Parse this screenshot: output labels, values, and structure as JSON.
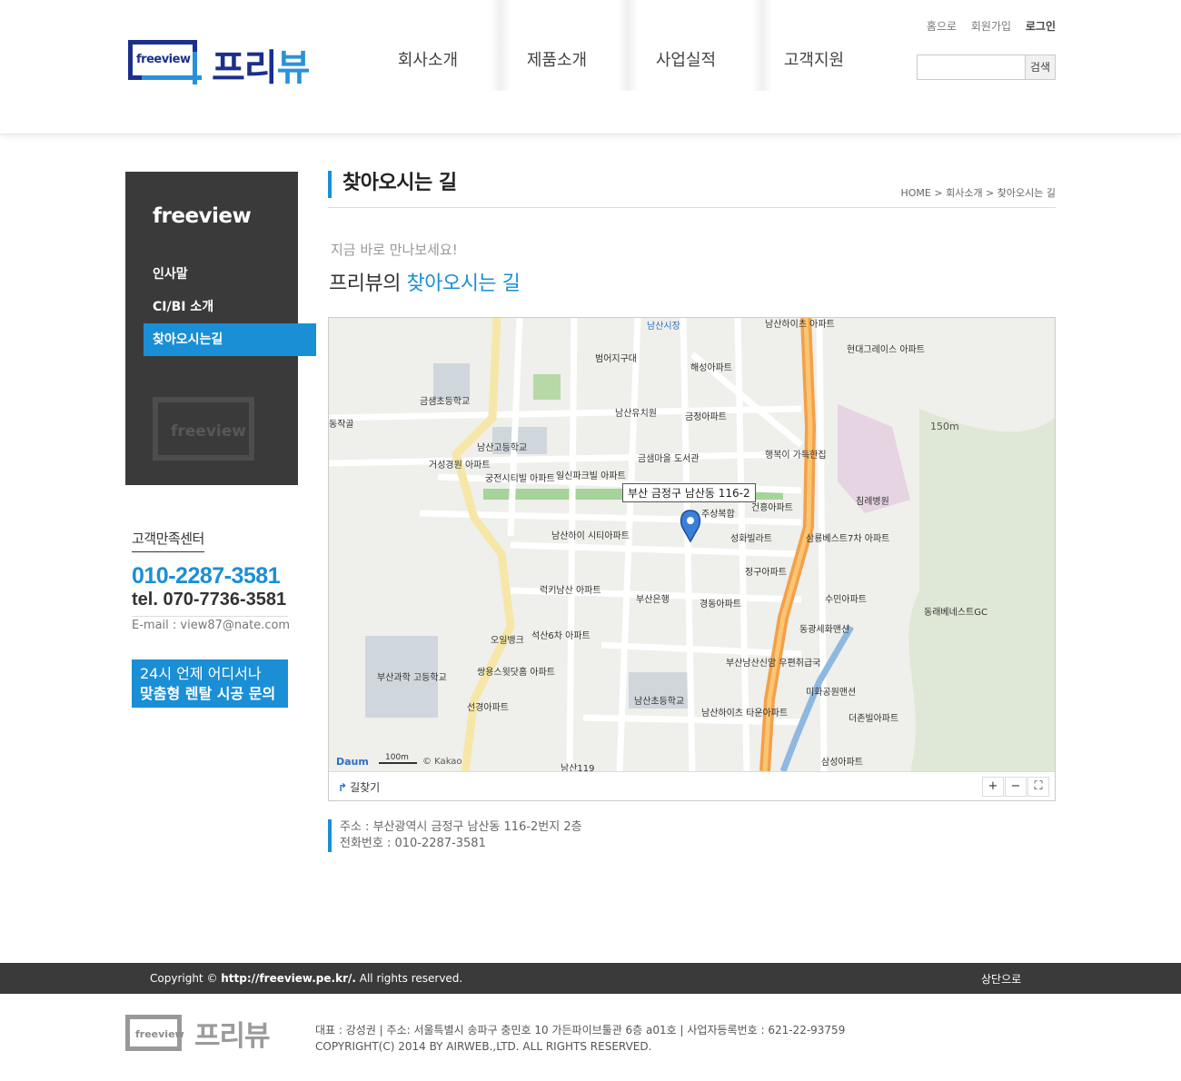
{
  "header": {
    "logo_mark_text": "freeview",
    "logo_name_a": "프리",
    "logo_name_b": "뷰",
    "nav": [
      "회사소개",
      "제품소개",
      "사업실적",
      "고객지원"
    ],
    "util": {
      "home": "홈으로",
      "join": "회원가입",
      "login": "로그인"
    },
    "search": {
      "button": "검색",
      "value": ""
    }
  },
  "sidebar": {
    "title": "freeview",
    "items": [
      {
        "label": "인사말",
        "active": false
      },
      {
        "label": "CI/BI 소개",
        "active": false
      },
      {
        "label": "찾아오시는길",
        "active": true
      }
    ],
    "watermark": "freeview"
  },
  "customer_center": {
    "title": "고객만족센터",
    "phone": "010-2287-3581",
    "tel": "tel. 070-7736-3581",
    "email": "E-mail : view87@nate.com"
  },
  "banner": {
    "line1": "24시 언제 어디서나",
    "line2": "맞춤형 렌탈 시공 문의"
  },
  "content": {
    "page_title": "찾아오시는 길",
    "breadcrumb": "HOME > 회사소개 > 찾아오시는 길",
    "sub_small": "지금 바로 만나보세요!",
    "sub_big_prefix": "프리뷰의 ",
    "sub_big_highlight": "찾아오시는 길"
  },
  "map": {
    "marker_label": "부산 금정구 남산동 116-2",
    "route_label": "길찾기",
    "zoom_in": "+",
    "zoom_out": "−",
    "fullscreen": "⛶",
    "scale": "100m",
    "brand": "Daum",
    "copyright": "© Kakao",
    "elevation": "150m",
    "places": [
      "남산시장",
      "남산하이츠 아파트",
      "현대그레이스 아파트",
      "범어지구대",
      "해성아파트",
      "금샘초등학교",
      "동작골",
      "남산유치원",
      "금정아파트",
      "남산고등학교",
      "거성경원 아파트",
      "궁전시티빌 아파트",
      "일신파크빌 아파트",
      "금샘마을 도서관",
      "행복이 가득한집",
      "침례병원",
      "건흥아파트",
      "주상복합",
      "성화빌라트",
      "삼룡베스트7차 아파트",
      "남산하이 시티아파트",
      "정구아파트",
      "럭키남산 아파트",
      "부산은행",
      "경동아파트",
      "수민아파트",
      "동래베네스트GC",
      "동광세화맨션",
      "오일뱅크",
      "석산6차 아파트",
      "부산남산신암 우편취급국",
      "부산과학 고등학교",
      "쌍용스윗닷홈 아파트",
      "남산초등학교",
      "미화공원맨션",
      "선경아파트",
      "남산하이츠 타운아파트",
      "더존빌아파트",
      "삼성아파트",
      "남산119"
    ]
  },
  "address": {
    "line1": "주소 : 부산광역시 금정구 남산동 116-2번지 2층",
    "line2": "전화번호 : 010-2287-3581"
  },
  "footer": {
    "copyright_prefix": "Copyright © ",
    "copyright_url": "http://freeview.pe.kr/.",
    "copyright_suffix": " All rights reserved.",
    "top_link": "상단으로",
    "logo_mark_text": "freeview",
    "logo_name": "프리뷰",
    "info_line1": "대표 : 강성권 | 주소: 서울특별시 송파구 충민호 10 가든파이브툴관 6층 a01호 | 사업자등록번호 : 621-22-93759",
    "info_line2": "COPYRIGHT(C) 2014 BY AIRWEB.,LTD. ALL RIGHTS RESERVED."
  },
  "colors": {
    "accent": "#1a8fd6",
    "brand_dark": "#1c2f8c",
    "sidebar_bg": "#3a3a3a",
    "footer_bg": "#3a3a3a"
  }
}
